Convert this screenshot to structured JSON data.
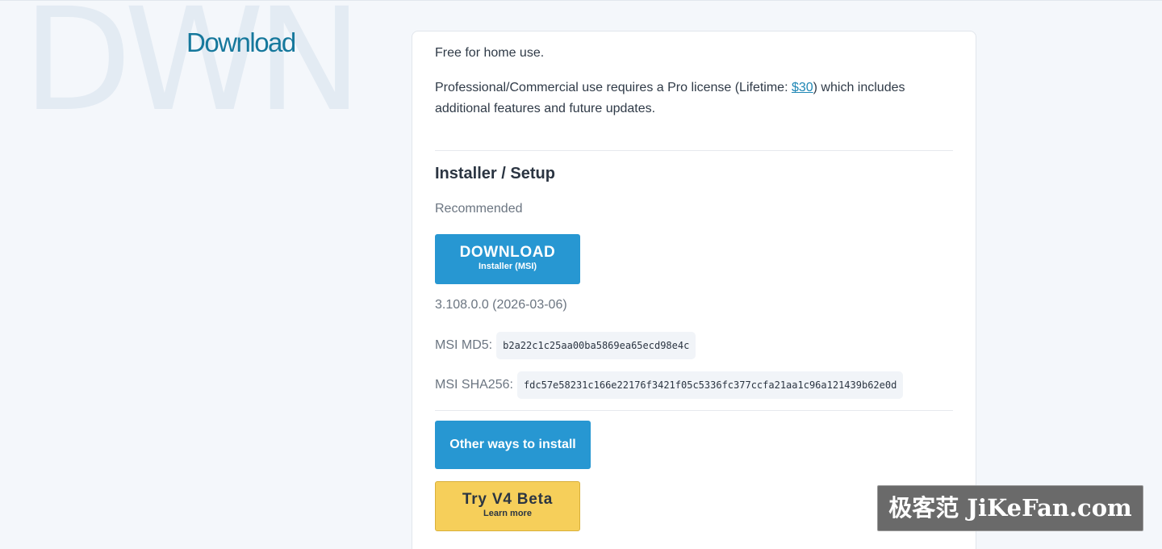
{
  "background_watermark": "DWN",
  "section_title": "Download",
  "intro": {
    "free_text": "Free for home use.",
    "license_before": "Professional/Commercial use requires a Pro license (Lifetime: ",
    "price_link": "$30",
    "license_after": ") which includes additional features and future updates."
  },
  "installer": {
    "heading": "Installer / Setup",
    "recommended": "Recommended",
    "download_button": {
      "label": "DOWNLOAD",
      "sublabel": "Installer (MSI)"
    },
    "version": "3.108.0.0 (2026-03-06)",
    "md5": {
      "label": "MSI MD5:",
      "value": "b2a22c1c25aa00ba5869ea65ecd98e4c"
    },
    "sha256": {
      "label": "MSI SHA256:",
      "value": "fdc57e58231c166e22176f3421f05c5336fc377ccfa21aa1c96a121439b62e0d"
    }
  },
  "other_ways_button": "Other ways to install",
  "beta_button": {
    "label": "Try V4 Beta",
    "sublabel": "Learn more"
  },
  "site_watermark": "极客范 JiKeFan.com",
  "colors": {
    "page_background": "#f4f7fb",
    "title": "#16789c",
    "primary_button": "#2797d2",
    "beta_button": "#f6cf5a",
    "link": "#1f87b5"
  }
}
